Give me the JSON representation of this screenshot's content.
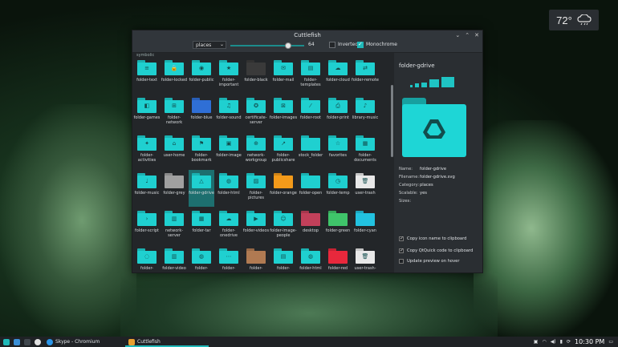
{
  "weather": {
    "temp": "72°",
    "icon": "cloud-rain-icon"
  },
  "window": {
    "title": "Cuttlefish",
    "controls": [
      "⌄",
      "⌃",
      "✕"
    ],
    "toolbar": {
      "category_value": "places",
      "size_value": "64",
      "size_fraction": 0.78,
      "inverted_label": "Inverted",
      "inverted_checked": false,
      "monochrome_label": "Monochrome",
      "monochrome_checked": true
    },
    "grid_top_label": "symbolic",
    "icons": [
      [
        {
          "label": "folder-text",
          "c": "#1fd0d0",
          "g": "≡"
        },
        {
          "label": "folder-locked",
          "c": "#1fd0d0",
          "g": "🔒"
        },
        {
          "label": "folder-public",
          "c": "#1fd0d0",
          "g": "◉"
        },
        {
          "label": "folder-important",
          "c": "#1fd0d0",
          "g": "★"
        },
        {
          "label": "folder-black",
          "c": "#3a3a3a",
          "g": ""
        },
        {
          "label": "folder-mail",
          "c": "#1fd0d0",
          "g": "✉"
        },
        {
          "label": "folder-templates",
          "c": "#1fd0d0",
          "g": "▤"
        },
        {
          "label": "folder-cloud",
          "c": "#1fd0d0",
          "g": "☁"
        },
        {
          "label": "folder-remote",
          "c": "#1fd0d0",
          "g": "⇄"
        }
      ],
      [
        {
          "label": "folder-games",
          "c": "#1fd0d0",
          "g": "◧"
        },
        {
          "label": "folder-network",
          "c": "#1fd0d0",
          "g": "⊞"
        },
        {
          "label": "folder-blue",
          "c": "#2f6fd6",
          "g": ""
        },
        {
          "label": "folder-sound",
          "c": "#1fd0d0",
          "g": "♫"
        },
        {
          "label": "certificate-server",
          "c": "#1fd0d0",
          "g": "✪"
        },
        {
          "label": "folder-images",
          "c": "#1fd0d0",
          "g": "⊠"
        },
        {
          "label": "folder-root",
          "c": "#1fd0d0",
          "g": "⁄"
        },
        {
          "label": "folder-print",
          "c": "#1fd0d0",
          "g": "⎙"
        },
        {
          "label": "library-music",
          "c": "#1fd0d0",
          "g": "♪"
        }
      ],
      [
        {
          "label": "folder-activities",
          "c": "#1fd0d0",
          "g": "✦"
        },
        {
          "label": "user-home",
          "c": "#1fd0d0",
          "g": "⌂"
        },
        {
          "label": "folder-bookmark",
          "c": "#1fd0d0",
          "g": "⚑"
        },
        {
          "label": "folder-image",
          "c": "#1fd0d0",
          "g": "▣"
        },
        {
          "label": "network-workgroup",
          "c": "#1fd0d0",
          "g": "⊕"
        },
        {
          "label": "folder-publicshare",
          "c": "#1fd0d0",
          "g": "↗"
        },
        {
          "label": "stock_folder",
          "c": "#1fd0d0",
          "g": ""
        },
        {
          "label": "favorites",
          "c": "#1fd0d0",
          "g": "☆"
        },
        {
          "label": "folder-documents",
          "c": "#1fd0d0",
          "g": "▦"
        }
      ],
      [
        {
          "label": "folder-music",
          "c": "#1fd0d0",
          "g": "♩"
        },
        {
          "label": "folder-grey",
          "c": "#a0a0a0",
          "g": ""
        },
        {
          "label": "folder-gdrive",
          "c": "#1fd0d0",
          "g": "△",
          "sel": true
        },
        {
          "label": "folder-html",
          "c": "#1fd0d0",
          "g": "◍"
        },
        {
          "label": "folder-pictures",
          "c": "#1fd0d0",
          "g": "▨"
        },
        {
          "label": "folder-orange",
          "c": "#f39a1a",
          "g": ""
        },
        {
          "label": "folder-open",
          "c": "#1fd0d0",
          "g": ""
        },
        {
          "label": "folder-temp",
          "c": "#1fd0d0",
          "g": "◷"
        },
        {
          "label": "user-trash",
          "c": "#e8e8e8",
          "g": "🗑"
        }
      ],
      [
        {
          "label": "folder-script",
          "c": "#1fd0d0",
          "g": "›"
        },
        {
          "label": "network-server",
          "c": "#1fd0d0",
          "g": "▥"
        },
        {
          "label": "folder-tar",
          "c": "#1fd0d0",
          "g": "▦"
        },
        {
          "label": "folder-onedrive",
          "c": "#1fd0d0",
          "g": "☁"
        },
        {
          "label": "folder-videos",
          "c": "#1fd0d0",
          "g": "▶"
        },
        {
          "label": "folder-image-people",
          "c": "#1fd0d0",
          "g": "☺"
        },
        {
          "label": "desktop",
          "c": "#c2405a",
          "g": ""
        },
        {
          "label": "folder-green",
          "c": "#3fc46a",
          "g": ""
        },
        {
          "label": "folder-cyan",
          "c": "#22c2e0",
          "g": ""
        }
      ],
      [
        {
          "label": "folder-",
          "c": "#1fd0d0",
          "g": "◌"
        },
        {
          "label": "folder-video",
          "c": "#1fd0d0",
          "g": "▥"
        },
        {
          "label": "folder-",
          "c": "#1fd0d0",
          "g": "◍"
        },
        {
          "label": "folder-",
          "c": "#1fd0d0",
          "g": "⋯"
        },
        {
          "label": "folder-",
          "c": "#b07a52",
          "g": ""
        },
        {
          "label": "folder-",
          "c": "#1fd0d0",
          "g": "▤"
        },
        {
          "label": "folder-html",
          "c": "#1fd0d0",
          "g": "◍"
        },
        {
          "label": "folder-red",
          "c": "#e8283c",
          "g": ""
        },
        {
          "label": "user-trash-",
          "c": "#e8e8e8",
          "g": "🗑"
        }
      ]
    ],
    "preview": {
      "title": "folder-gdrive",
      "meta": [
        {
          "k": "Name:",
          "v": "folder-gdrive"
        },
        {
          "k": "Filename:",
          "v": "folder-gdrive.svg"
        },
        {
          "k": "Category:",
          "v": "places"
        },
        {
          "k": "Scalable:",
          "v": "yes"
        },
        {
          "k": "Sizes:",
          "v": ""
        }
      ],
      "options": [
        {
          "label": "Copy icon name to clipboard",
          "checked": true
        },
        {
          "label": "Copy QtQuick code to clipboard",
          "checked": true
        },
        {
          "label": "Update preview on hover",
          "checked": false
        }
      ]
    }
  },
  "taskbar": {
    "apps": [
      {
        "label": "Skype - Chromium",
        "icon": "skype-icon"
      },
      {
        "label": "Cuttlefish",
        "icon": "cuttlefish-icon"
      }
    ],
    "clock": "10:30 PM"
  }
}
